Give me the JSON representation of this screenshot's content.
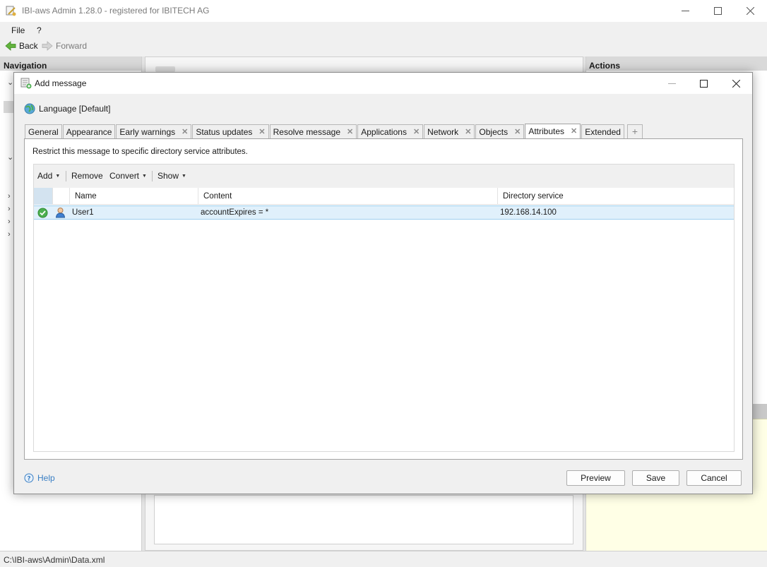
{
  "window": {
    "title": "IBI-aws Admin 1.28.0 - registered for IBITECH AG",
    "app_icon": "app-logo-icon"
  },
  "menu": {
    "file": "File",
    "help": "?"
  },
  "toolbar": {
    "back": "Back",
    "forward": "Forward"
  },
  "panels": {
    "navigation": "Navigation",
    "actions": "Actions"
  },
  "dialog": {
    "title": "Add message",
    "language": "Language [Default]",
    "tabs": [
      {
        "label": "General",
        "closable": false
      },
      {
        "label": "Appearance",
        "closable": false
      },
      {
        "label": "Early warnings",
        "closable": true
      },
      {
        "label": "Status updates",
        "closable": true
      },
      {
        "label": "Resolve message",
        "closable": true
      },
      {
        "label": "Applications",
        "closable": true
      },
      {
        "label": "Network",
        "closable": true
      },
      {
        "label": "Objects",
        "closable": true
      },
      {
        "label": "Attributes",
        "closable": true,
        "active": true
      },
      {
        "label": "Extended",
        "closable": false
      }
    ],
    "tab_close_glyph": "✕",
    "tab_add_glyph": "+",
    "description": "Restrict this message to specific directory service attributes.",
    "grid_toolbar": {
      "add": "Add",
      "remove": "Remove",
      "convert": "Convert",
      "show": "Show"
    },
    "columns": {
      "name": "Name",
      "content": "Content",
      "directory": "Directory service"
    },
    "rows": [
      {
        "name": "User1",
        "content": "accountExpires = *",
        "directory": "192.168.14.100"
      }
    ],
    "help": "Help",
    "buttons": {
      "preview": "Preview",
      "save": "Save",
      "cancel": "Cancel"
    }
  },
  "statusbar": {
    "path": "C:\\IBI-aws\\Admin\\Data.xml"
  },
  "colors": {
    "accent": "#3a7fc4",
    "row_selected": "#e0f0fb",
    "row_border": "#9fcfee",
    "back_arrow": "#4caf50"
  }
}
